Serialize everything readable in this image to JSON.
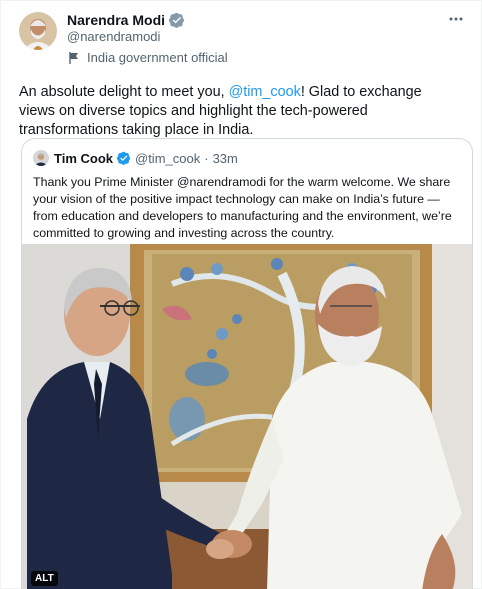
{
  "author": {
    "name": "Narendra Modi",
    "handle": "@narendramodi",
    "affiliation": "India government official"
  },
  "tweet": {
    "text_before": "An absolute delight to meet you, ",
    "mention": "@tim_cook",
    "text_after": "! Glad to exchange views on diverse topics and highlight the tech-powered transformations taking place in India."
  },
  "quote": {
    "name": "Tim Cook",
    "handle": "@tim_cook",
    "time": "33m",
    "text": "Thank you Prime Minister @narendramodi for the warm welcome. We share your vision of the positive impact technology can make on India’s future — from education and developers to manufacturing and the environment, we’re committed to growing and investing across the country."
  },
  "media": {
    "alt_badge": "ALT"
  },
  "colors": {
    "accent": "#1d9bf0",
    "secondary_text": "#536471",
    "border": "#cfd9de"
  }
}
